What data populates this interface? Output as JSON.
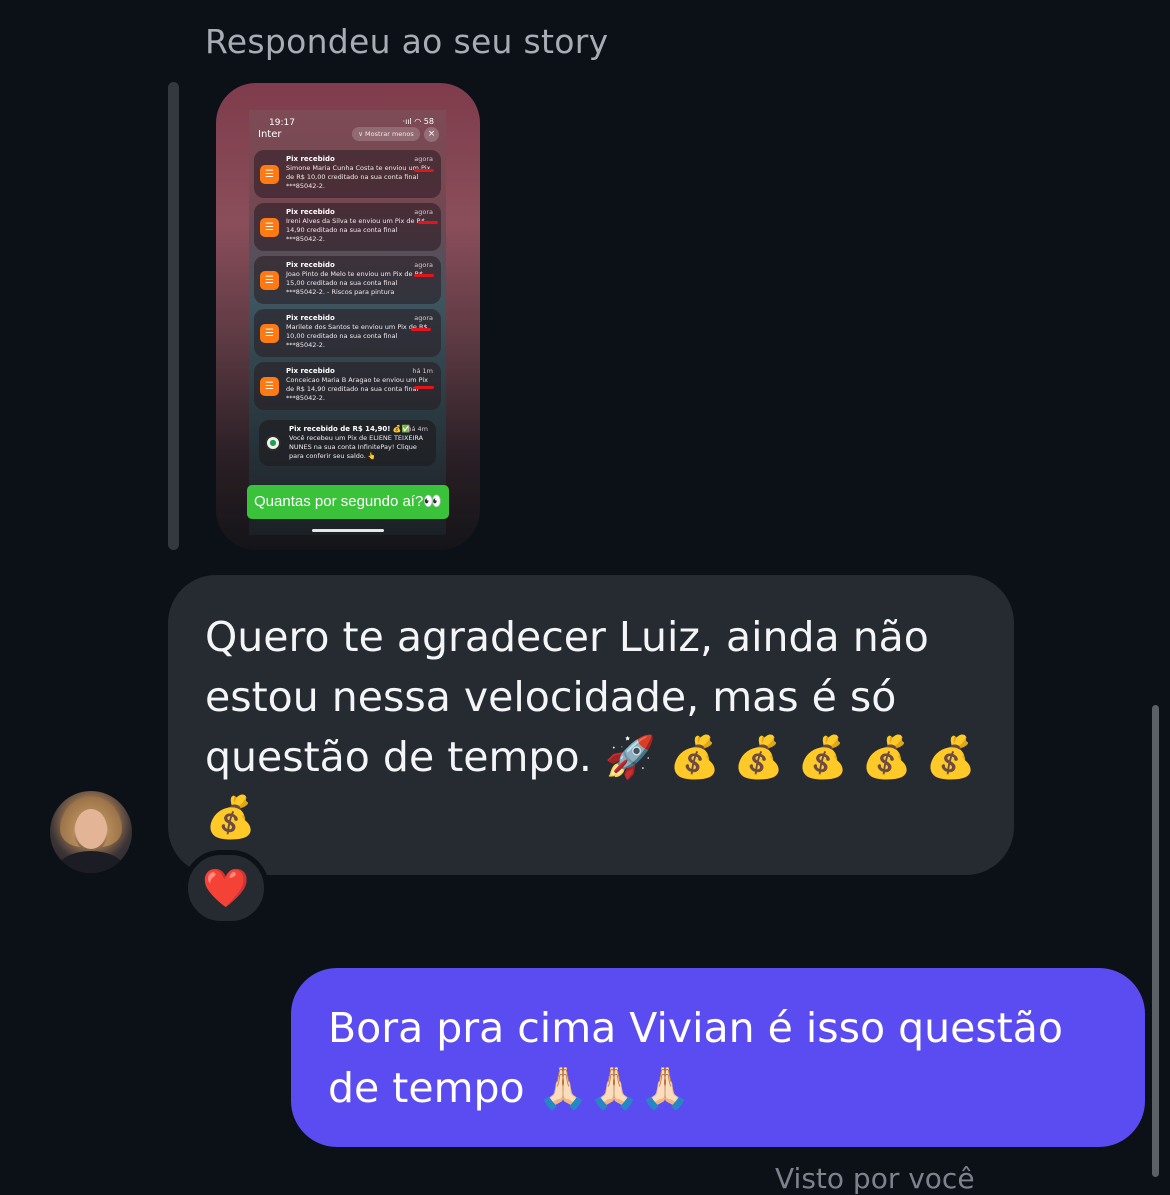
{
  "header": {
    "story_reply_label": "Respondeu ao seu story"
  },
  "story": {
    "status_time": "19:17",
    "status_icons": "·ııl ◠ 58",
    "app_title": "Inter",
    "collapse_label": "∨  Mostrar menos",
    "close_icon": "×",
    "notifications": [
      {
        "title": "Pix recebido",
        "time": "agora",
        "body": "Simone Maria Cunha Costa te enviou um Pix de R$ 10,00 creditado na sua conta final ***85042-2."
      },
      {
        "title": "Pix recebido",
        "time": "agora",
        "body": "Ireni Alves da Silva te enviou um Pix de R$ 14,90 creditado na sua conta final ***85042-2."
      },
      {
        "title": "Pix recebido",
        "time": "agora",
        "body": "Joao Pinto de Melo te enviou um Pix de R$ 15,00 creditado na sua conta final ***85042-2. - Riscos para pintura"
      },
      {
        "title": "Pix recebido",
        "time": "agora",
        "body": "Marilete dos Santos te enviou um Pix de R$ 10,00 creditado na sua conta final ***85042-2."
      },
      {
        "title": "Pix recebido",
        "time": "há 1m",
        "body": "Conceicao Maria B Aragao te enviou um Pix de R$ 14,90 creditado na sua conta final ***85042-2."
      }
    ],
    "last_notification": {
      "title": "Pix recebido de R$ 14,90! 💰✅",
      "time": "há 4m",
      "body": "Você recebeu um Pix de ELIENE TEIXEIRA NUNES na sua conta InfinitePay! Clique para conferir seu saldo. 👆"
    },
    "sticker_text": "Quantas por segundo aí?👀"
  },
  "messages": {
    "incoming": "Quero te agradecer Luiz, ainda não estou nessa velocidade, mas é só questão de tempo. 🚀 💰 💰 💰 💰 💰 💰",
    "incoming_reaction": "❤️",
    "outgoing": "Bora pra cima Vivian é isso questão de tempo 🙏🏻🙏🏻🙏🏻",
    "seen_status": "Visto por você"
  },
  "colors": {
    "background": "#0c1017",
    "incoming_bubble": "#262a31",
    "outgoing_bubble": "#5b4cf2",
    "sticker_green": "#3bc23b",
    "inter_orange": "#ff7a12"
  },
  "icons": {
    "notification_app": "inter-logo-icon",
    "reaction": "heart-icon",
    "avatar": "avatar"
  }
}
